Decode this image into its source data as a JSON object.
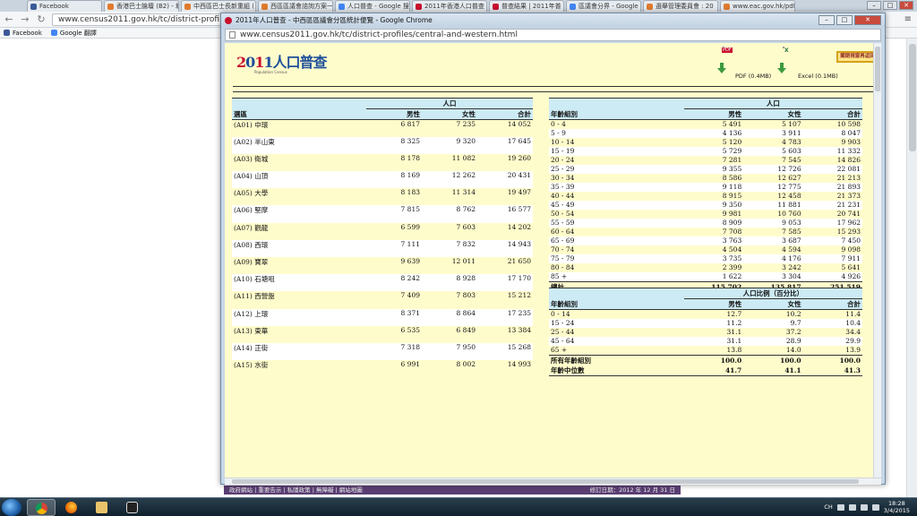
{
  "background_browser": {
    "tabs": [
      {
        "label": "Facebook",
        "fav": "fb"
      },
      {
        "label": "香港巴士論壇 (B2) - 城",
        "fav": ""
      },
      {
        "label": "中西區巴士長新重組 (",
        "fav": ""
      },
      {
        "label": "西區區議會諮詢方案一",
        "fav": ""
      },
      {
        "label": "人口普查 - Google 搜",
        "fav": "go"
      },
      {
        "label": "2011年香港人口普查",
        "fav": "cs"
      },
      {
        "label": "普查結果 | 2011年普",
        "fav": "cs"
      },
      {
        "label": "區議會分界 - Google",
        "fav": "go"
      },
      {
        "label": "選舉管理委員會 : 20",
        "fav": ""
      },
      {
        "label": "www.eac.gov.hk/pdf/",
        "fav": ""
      }
    ],
    "url": "www.census2011.gov.hk/tc/district-profiles.h",
    "bookmarks": [
      {
        "label": "Facebook",
        "fav": "fb"
      },
      {
        "label": "Google 翻譯",
        "fav": "gg"
      }
    ],
    "footer_links": "政府網站 | 重要告示 | 私隱政策 | 無障礙 | 網站地圖",
    "footer_date": "修訂日期：2012 年 12 月 31 日"
  },
  "popup": {
    "title": "2011年人口普查 - 中西區區議會分區統計便覽 - Google Chrome",
    "url": "www.census2011.gov.hk/tc/district-profiles/central-and-western.html",
    "logo_text": "2011人口普查",
    "logo_sub": "Population Census",
    "pdf_label": "PDF (0.4MB)",
    "excel_label": "Excel (0.1MB)",
    "close_label": "關閉視窗再返回"
  },
  "districts_table": {
    "group_header": "人口",
    "col_area": "選區",
    "col_male": "男性",
    "col_female": "女性",
    "col_total": "合計",
    "rows": [
      [
        "(A01) 中環",
        "6 817",
        "7 235",
        "14 052"
      ],
      [
        "(A02) 半山東",
        "8 325",
        "9 320",
        "17 645"
      ],
      [
        "(A03) 衛城",
        "8 178",
        "11 082",
        "19 260"
      ],
      [
        "(A04) 山頂",
        "8 169",
        "12 262",
        "20 431"
      ],
      [
        "(A05) 大學",
        "8 183",
        "11 314",
        "19 497"
      ],
      [
        "(A06) 堅摩",
        "7 815",
        "8 762",
        "16 577"
      ],
      [
        "(A07) 觀龍",
        "6 599",
        "7 603",
        "14 202"
      ],
      [
        "(A08) 西環",
        "7 111",
        "7 832",
        "14 943"
      ],
      [
        "(A09) 寶翠",
        "9 639",
        "12 011",
        "21 650"
      ],
      [
        "(A10) 石塘咀",
        "8 242",
        "8 928",
        "17 170"
      ],
      [
        "(A11) 西營盤",
        "7 409",
        "7 803",
        "15 212"
      ],
      [
        "(A12) 上環",
        "8 371",
        "8 864",
        "17 235"
      ],
      [
        "(A13) 東華",
        "6 535",
        "6 849",
        "13 384"
      ],
      [
        "(A14) 正街",
        "7 318",
        "7 950",
        "15 268"
      ],
      [
        "(A15) 水街",
        "6 991",
        "8 002",
        "14 993"
      ]
    ]
  },
  "ages_table": {
    "group_header": "人口",
    "col_age": "年齡組別",
    "col_male": "男性",
    "col_female": "女性",
    "col_total": "合計",
    "rows": [
      [
        " 0 -  4",
        "5 491",
        "5 107",
        "10 598"
      ],
      [
        " 5 -  9",
        "4 136",
        "3 911",
        "8 047"
      ],
      [
        "10 - 14",
        "5 120",
        "4 783",
        "9 903"
      ],
      [
        "15 - 19",
        "5 729",
        "5 603",
        "11 332"
      ],
      [
        "20 - 24",
        "7 281",
        "7 545",
        "14 826"
      ],
      [
        "25 - 29",
        "9 355",
        "12 726",
        "22 081"
      ],
      [
        "30 - 34",
        "8 586",
        "12 627",
        "21 213"
      ],
      [
        "35 - 39",
        "9 118",
        "12 775",
        "21 893"
      ],
      [
        "40 - 44",
        "8 915",
        "12 458",
        "21 373"
      ],
      [
        "45 - 49",
        "9 350",
        "11 881",
        "21 231"
      ],
      [
        "50 - 54",
        "9 981",
        "10 760",
        "20 741"
      ],
      [
        "55 - 59",
        "8 909",
        "9 053",
        "17 962"
      ],
      [
        "60 - 64",
        "7 708",
        "7 585",
        "15 293"
      ],
      [
        "65 - 69",
        "3 763",
        "3 687",
        "7 450"
      ],
      [
        "70 - 74",
        "4 504",
        "4 594",
        "9 098"
      ],
      [
        "75 - 79",
        "3 735",
        "4 176",
        "7 911"
      ],
      [
        "80 - 84",
        "2 399",
        "3 242",
        "5 641"
      ],
      [
        "85 +",
        "1 622",
        "3 304",
        "4 926"
      ]
    ],
    "total": [
      "總計",
      "115 702",
      "135 817",
      "251 519"
    ]
  },
  "ratio_table": {
    "group_header": "人口比例（百分比）",
    "col_age": "年齡組別",
    "col_male": "男性",
    "col_female": "女性",
    "col_total": "合計",
    "rows": [
      [
        " 0 - 14",
        "12.7",
        "10.2",
        "11.4"
      ],
      [
        "15 - 24",
        "11.2",
        "9.7",
        "10.4"
      ],
      [
        "25 - 44",
        "31.1",
        "37.2",
        "34.4"
      ],
      [
        "45 - 64",
        "31.1",
        "28.9",
        "29.9"
      ],
      [
        "65 +",
        "13.8",
        "14.0",
        "13.9"
      ]
    ],
    "total_all": [
      "所有年齡組別",
      "100.0",
      "100.0",
      "100.0"
    ],
    "median": [
      "年齡中位數",
      "41.7",
      "41.1",
      "41.3"
    ]
  },
  "taskbar": {
    "lang": "CH",
    "time": "18:28",
    "date": "3/4/2015"
  }
}
